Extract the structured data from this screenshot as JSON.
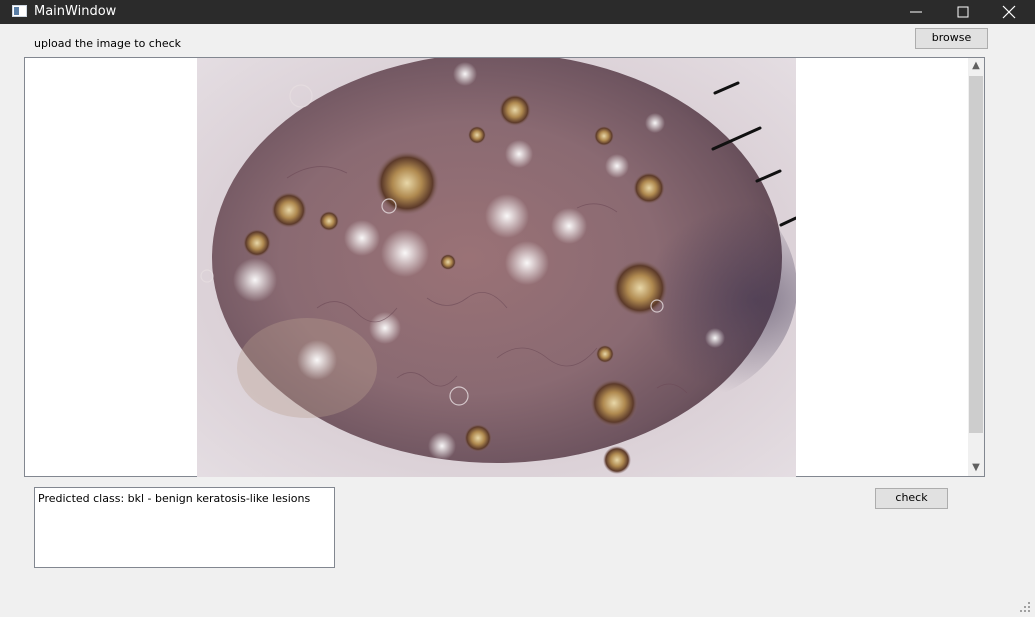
{
  "window": {
    "title": "MainWindow"
  },
  "upload": {
    "label": "upload the image to check",
    "browse_label": "browse"
  },
  "viewer": {
    "image_description_icon": "skin-lesion-dermoscopy-image",
    "scroll_up_glyph": "▲",
    "scroll_down_glyph": "▼"
  },
  "result": {
    "text": "Predicted class: bkl - benign keratosis-like lesions"
  },
  "actions": {
    "check_label": "check"
  }
}
